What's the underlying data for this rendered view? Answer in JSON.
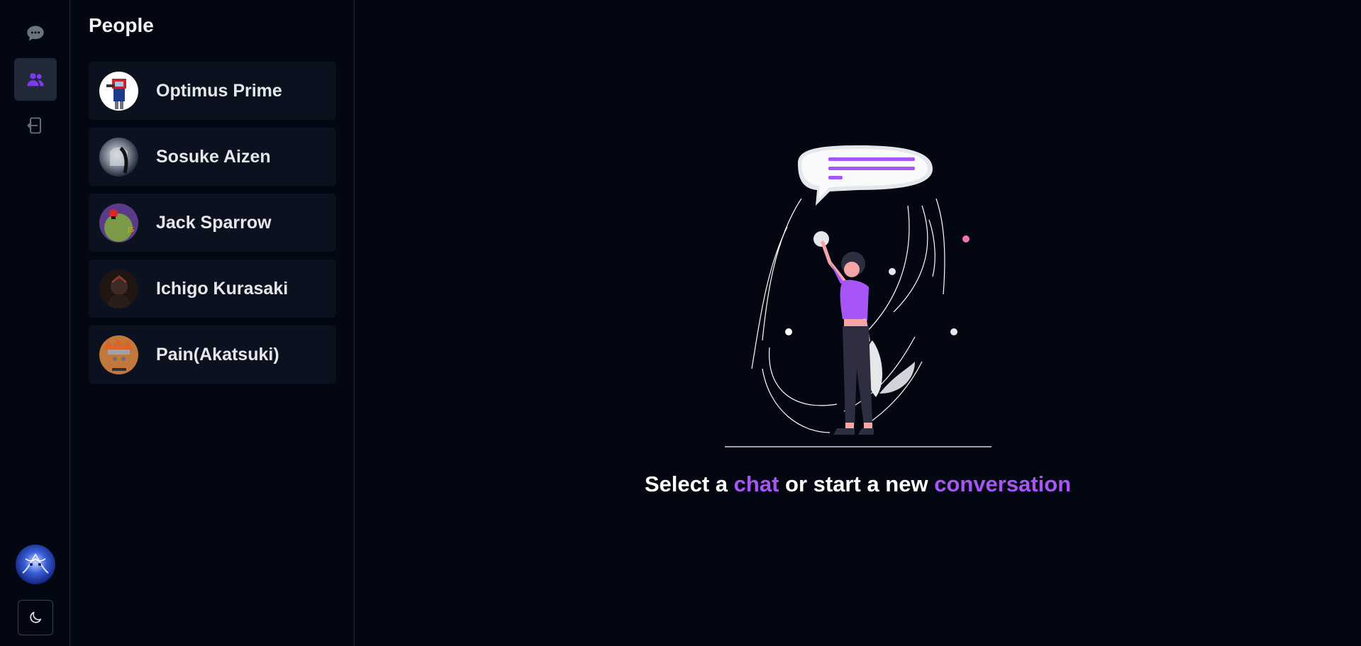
{
  "rail": {
    "items": [
      {
        "icon": "chat-bubble-icon",
        "active": false
      },
      {
        "icon": "users-icon",
        "active": true
      },
      {
        "icon": "logout-icon",
        "active": false
      }
    ],
    "theme_icon": "moon-icon"
  },
  "people": {
    "title": "People",
    "list": [
      {
        "name": "Optimus Prime",
        "avatar_color": "#ffffff"
      },
      {
        "name": "Sosuke Aizen",
        "avatar_color": "#9ca3af"
      },
      {
        "name": "Jack Sparrow",
        "avatar_color": "#6b8e3a"
      },
      {
        "name": "Ichigo Kurasaki",
        "avatar_color": "#3f2a25"
      },
      {
        "name": "Pain(Akatsuki)",
        "avatar_color": "#c2783a"
      }
    ]
  },
  "main": {
    "prompt_part1": "Select a ",
    "prompt_accent1": "chat",
    "prompt_part2": " or start a new ",
    "prompt_accent2": "conversation"
  },
  "colors": {
    "accent": "#a855f7",
    "background": "#030712",
    "card": "#0b111e"
  }
}
